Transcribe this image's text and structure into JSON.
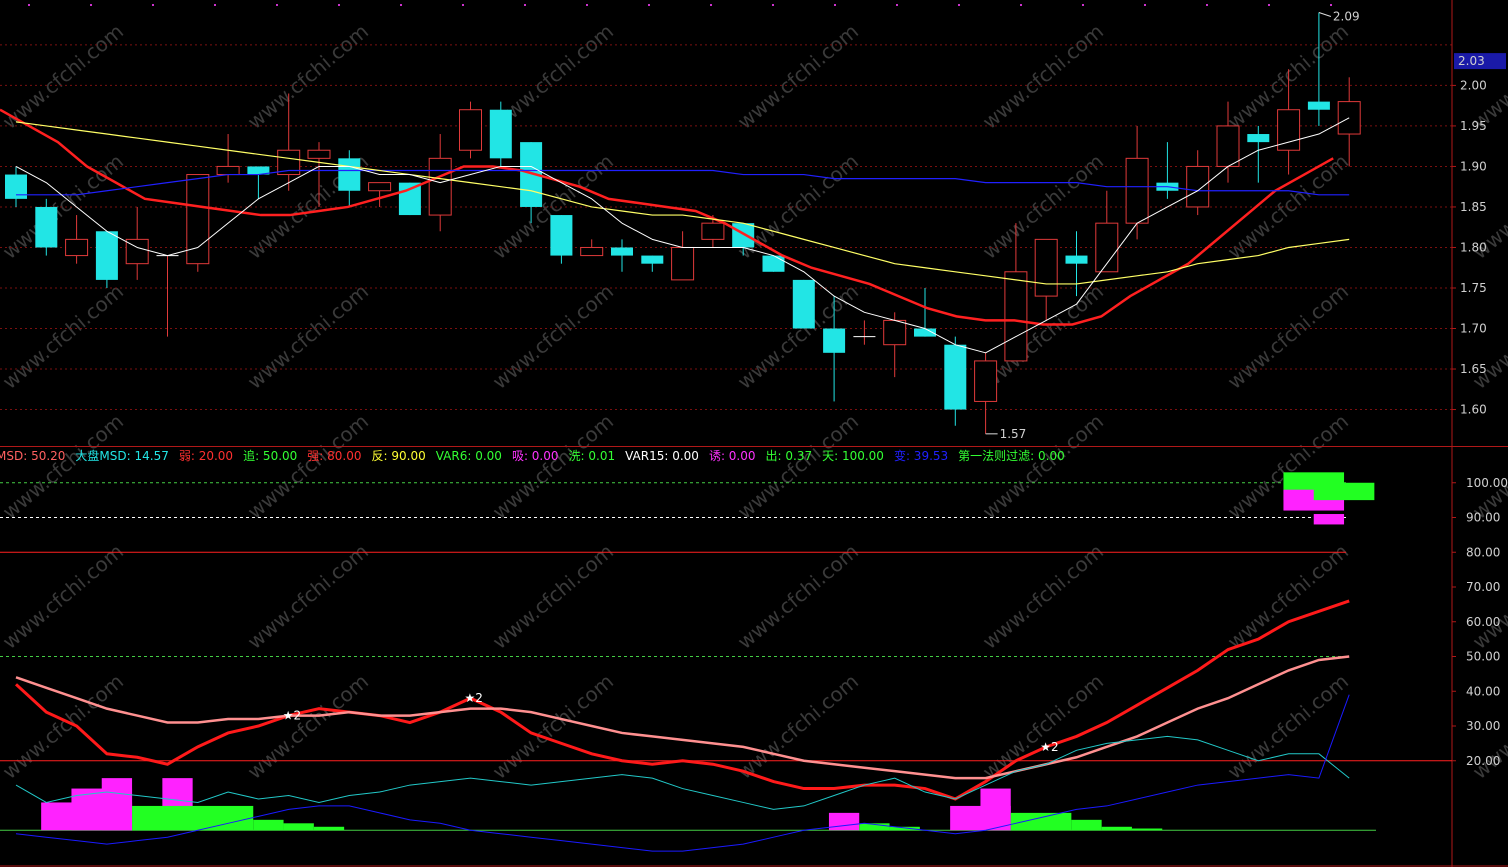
{
  "chart_data": [
    {
      "type": "candlestick",
      "panel": "price",
      "y_ticks": [
        "2.00",
        "1.95",
        "1.90",
        "1.85",
        "1.80",
        "1.75",
        "1.70",
        "1.65",
        "1.60"
      ],
      "ylim": [
        1.555,
        2.098
      ],
      "current_price": "2.03",
      "high_marker": "2.09",
      "low_marker": "1.57",
      "high_index": 43,
      "low_index": 32,
      "colors": {
        "up": "#e03a3a",
        "down": "#22e5e5",
        "ma1": "#ffffff",
        "ma2": "#ff2020",
        "ma3": "#ffff66",
        "ma4": "#2020ff"
      },
      "candles": [
        {
          "o": 1.89,
          "h": 1.9,
          "l": 1.85,
          "c": 1.86
        },
        {
          "o": 1.85,
          "h": 1.86,
          "l": 1.79,
          "c": 1.8
        },
        {
          "o": 1.79,
          "h": 1.84,
          "l": 1.78,
          "c": 1.81
        },
        {
          "o": 1.82,
          "h": 1.82,
          "l": 1.75,
          "c": 1.76
        },
        {
          "o": 1.78,
          "h": 1.85,
          "l": 1.76,
          "c": 1.81
        },
        {
          "o": 1.79,
          "h": 1.79,
          "l": 1.69,
          "c": 1.79
        },
        {
          "o": 1.78,
          "h": 1.89,
          "l": 1.77,
          "c": 1.89
        },
        {
          "o": 1.89,
          "h": 1.94,
          "l": 1.88,
          "c": 1.9
        },
        {
          "o": 1.9,
          "h": 1.9,
          "l": 1.86,
          "c": 1.89
        },
        {
          "o": 1.89,
          "h": 1.99,
          "l": 1.87,
          "c": 1.92
        },
        {
          "o": 1.91,
          "h": 1.93,
          "l": 1.85,
          "c": 1.92
        },
        {
          "o": 1.91,
          "h": 1.92,
          "l": 1.85,
          "c": 1.87
        },
        {
          "o": 1.87,
          "h": 1.88,
          "l": 1.85,
          "c": 1.88
        },
        {
          "o": 1.88,
          "h": 1.88,
          "l": 1.84,
          "c": 1.84
        },
        {
          "o": 1.84,
          "h": 1.94,
          "l": 1.82,
          "c": 1.91
        },
        {
          "o": 1.92,
          "h": 1.98,
          "l": 1.91,
          "c": 1.97
        },
        {
          "o": 1.97,
          "h": 1.98,
          "l": 1.9,
          "c": 1.91
        },
        {
          "o": 1.93,
          "h": 1.93,
          "l": 1.83,
          "c": 1.85
        },
        {
          "o": 1.84,
          "h": 1.84,
          "l": 1.78,
          "c": 1.79
        },
        {
          "o": 1.79,
          "h": 1.81,
          "l": 1.79,
          "c": 1.8
        },
        {
          "o": 1.8,
          "h": 1.81,
          "l": 1.77,
          "c": 1.79
        },
        {
          "o": 1.79,
          "h": 1.79,
          "l": 1.77,
          "c": 1.78
        },
        {
          "o": 1.76,
          "h": 1.82,
          "l": 1.76,
          "c": 1.8
        },
        {
          "o": 1.81,
          "h": 1.84,
          "l": 1.8,
          "c": 1.83
        },
        {
          "o": 1.83,
          "h": 1.83,
          "l": 1.79,
          "c": 1.8
        },
        {
          "o": 1.79,
          "h": 1.79,
          "l": 1.77,
          "c": 1.77
        },
        {
          "o": 1.76,
          "h": 1.76,
          "l": 1.7,
          "c": 1.7
        },
        {
          "o": 1.7,
          "h": 1.74,
          "l": 1.61,
          "c": 1.67
        },
        {
          "o": 1.69,
          "h": 1.71,
          "l": 1.68,
          "c": 1.69
        },
        {
          "o": 1.68,
          "h": 1.72,
          "l": 1.64,
          "c": 1.71
        },
        {
          "o": 1.7,
          "h": 1.75,
          "l": 1.69,
          "c": 1.69
        },
        {
          "o": 1.68,
          "h": 1.69,
          "l": 1.58,
          "c": 1.6
        },
        {
          "o": 1.61,
          "h": 1.67,
          "l": 1.57,
          "c": 1.66
        },
        {
          "o": 1.66,
          "h": 1.83,
          "l": 1.66,
          "c": 1.77
        },
        {
          "o": 1.74,
          "h": 1.81,
          "l": 1.71,
          "c": 1.81
        },
        {
          "o": 1.79,
          "h": 1.82,
          "l": 1.74,
          "c": 1.78
        },
        {
          "o": 1.77,
          "h": 1.87,
          "l": 1.77,
          "c": 1.83
        },
        {
          "o": 1.83,
          "h": 1.95,
          "l": 1.81,
          "c": 1.91
        },
        {
          "o": 1.88,
          "h": 1.93,
          "l": 1.86,
          "c": 1.87
        },
        {
          "o": 1.85,
          "h": 1.92,
          "l": 1.84,
          "c": 1.9
        },
        {
          "o": 1.9,
          "h": 1.98,
          "l": 1.88,
          "c": 1.95
        },
        {
          "o": 1.94,
          "h": 1.95,
          "l": 1.88,
          "c": 1.93
        },
        {
          "o": 1.92,
          "h": 2.02,
          "l": 1.89,
          "c": 1.97
        },
        {
          "o": 1.98,
          "h": 2.09,
          "l": 1.95,
          "c": 1.97
        },
        {
          "o": 1.94,
          "h": 2.01,
          "l": 1.9,
          "c": 1.98
        }
      ],
      "ma_fast": [
        1.9,
        1.88,
        1.85,
        1.82,
        1.8,
        1.79,
        1.8,
        1.83,
        1.86,
        1.88,
        1.9,
        1.9,
        1.89,
        1.89,
        1.88,
        1.89,
        1.9,
        1.9,
        1.88,
        1.86,
        1.83,
        1.81,
        1.8,
        1.8,
        1.8,
        1.79,
        1.77,
        1.74,
        1.72,
        1.71,
        1.7,
        1.68,
        1.67,
        1.69,
        1.71,
        1.73,
        1.78,
        1.83,
        1.85,
        1.87,
        1.9,
        1.92,
        1.93,
        1.94,
        1.96
      ],
      "ma_mid": [
        1.97,
        1.95,
        1.93,
        1.9,
        1.88,
        1.86,
        1.855,
        1.85,
        1.845,
        1.84,
        1.84,
        1.845,
        1.85,
        1.86,
        1.87,
        1.885,
        1.9,
        1.9,
        1.895,
        1.885,
        1.875,
        1.86,
        1.855,
        1.85,
        1.845,
        1.83,
        1.81,
        1.79,
        1.775,
        1.765,
        1.755,
        1.74,
        1.725,
        1.715,
        1.71,
        1.71,
        1.705,
        1.705,
        1.715,
        1.74,
        1.76,
        1.78,
        1.81,
        1.84,
        1.87,
        1.89,
        1.91
      ],
      "ma_slow": [
        1.955,
        1.95,
        1.945,
        1.94,
        1.935,
        1.93,
        1.925,
        1.92,
        1.915,
        1.91,
        1.905,
        1.9,
        1.895,
        1.89,
        1.885,
        1.88,
        1.875,
        1.87,
        1.86,
        1.85,
        1.845,
        1.84,
        1.84,
        1.835,
        1.83,
        1.82,
        1.81,
        1.8,
        1.79,
        1.78,
        1.775,
        1.77,
        1.765,
        1.76,
        1.755,
        1.755,
        1.76,
        1.765,
        1.77,
        1.78,
        1.785,
        1.79,
        1.8,
        1.805,
        1.81
      ],
      "ma_long": [
        1.865,
        1.865,
        1.865,
        1.87,
        1.875,
        1.88,
        1.885,
        1.89,
        1.89,
        1.895,
        1.895,
        1.895,
        1.895,
        1.895,
        1.895,
        1.895,
        1.895,
        1.895,
        1.895,
        1.895,
        1.895,
        1.895,
        1.895,
        1.895,
        1.89,
        1.89,
        1.89,
        1.885,
        1.885,
        1.885,
        1.885,
        1.885,
        1.88,
        1.88,
        1.88,
        1.88,
        1.875,
        1.875,
        1.875,
        1.87,
        1.87,
        1.87,
        1.87,
        1.865,
        1.865
      ]
    },
    {
      "type": "line",
      "panel": "indicator",
      "legend": [
        {
          "label": "MSD: 50.20",
          "color": "#ff6060"
        },
        {
          "label": "大盘MSD: 14.57",
          "color": "#22e5e5"
        },
        {
          "label": "弱: 20.00",
          "color": "#ff3030"
        },
        {
          "label": "追: 50.00",
          "color": "#33ff33"
        },
        {
          "label": "强: 80.00",
          "color": "#ff3030"
        },
        {
          "label": "反: 90.00",
          "color": "#ffff33"
        },
        {
          "label": "VAR6: 0.00",
          "color": "#33ff33"
        },
        {
          "label": "吸: 0.00",
          "color": "#ff33ff"
        },
        {
          "label": "洗: 0.01",
          "color": "#33ff33"
        },
        {
          "label": "VAR15: 0.00",
          "color": "#ffffff"
        },
        {
          "label": "诱: 0.00",
          "color": "#ff33ff"
        },
        {
          "label": "出: 0.37",
          "color": "#33ff33"
        },
        {
          "label": "天: 100.00",
          "color": "#33ff33"
        },
        {
          "label": "变: 39.53",
          "color": "#2020ff"
        },
        {
          "label": "第一法则过滤: 0.00",
          "color": "#33ff33"
        }
      ],
      "y_ticks": [
        "100.00",
        "90.00",
        "80.00",
        "70.00",
        "60.00",
        "50.00",
        "40.00",
        "30.00",
        "20.00"
      ],
      "ylim": [
        -10,
        110
      ],
      "levels": [
        {
          "name": "强",
          "value": 80,
          "color": "#ff2020",
          "style": "solid"
        },
        {
          "name": "追",
          "value": 50,
          "color": "#44cc44",
          "style": "dotted"
        },
        {
          "name": "弱",
          "value": 20,
          "color": "#ff2020",
          "style": "solid"
        },
        {
          "name": "反",
          "value": 90,
          "color": "#ffffff",
          "style": "dotted"
        },
        {
          "name": "天",
          "value": 100,
          "color": "#44cc44",
          "style": "dotted"
        }
      ],
      "stars": [
        {
          "index": 9,
          "label": "★2"
        },
        {
          "index": 15,
          "label": "★2"
        },
        {
          "index": 34,
          "label": "★2"
        }
      ],
      "series": [
        {
          "color": "#ff1a1a",
          "values": [
            42,
            34,
            30,
            22,
            21,
            19,
            24,
            28,
            30,
            33,
            35,
            34,
            33,
            31,
            34,
            38,
            34,
            28,
            25,
            22,
            20,
            19,
            20,
            19,
            17,
            14,
            12,
            12,
            13,
            13,
            12,
            9,
            14,
            20,
            24,
            27,
            31,
            36,
            41,
            46,
            52,
            55,
            60,
            63,
            66
          ]
        },
        {
          "color": "#ff9090",
          "values": [
            44,
            41,
            38,
            35,
            33,
            31,
            31,
            32,
            32,
            33,
            33,
            34,
            33,
            33,
            34,
            35,
            35,
            34,
            32,
            30,
            28,
            27,
            26,
            25,
            24,
            22,
            20,
            19,
            18,
            17,
            16,
            15,
            15,
            17,
            19,
            21,
            24,
            27,
            31,
            35,
            38,
            42,
            46,
            49,
            50
          ]
        },
        {
          "color": "#22c8c8",
          "values": [
            13,
            8,
            10,
            11,
            10,
            9,
            8,
            11,
            9,
            10,
            8,
            10,
            11,
            13,
            14,
            15,
            14,
            13,
            14,
            15,
            16,
            15,
            12,
            10,
            8,
            6,
            7,
            10,
            13,
            15,
            11,
            9,
            13,
            17,
            19,
            23,
            25,
            26,
            27,
            26,
            23,
            20,
            22,
            22,
            15
          ]
        },
        {
          "color": "#1a1aff",
          "values": [
            -1,
            -2,
            -3,
            -4,
            -3,
            -2,
            0,
            2,
            4,
            6,
            7,
            7,
            5,
            3,
            2,
            0,
            -1,
            -2,
            -3,
            -4,
            -5,
            -6,
            -6,
            -5,
            -4,
            -2,
            0,
            1,
            2,
            1,
            0,
            -1,
            0,
            2,
            4,
            6,
            7,
            9,
            11,
            13,
            14,
            15,
            16,
            15,
            39
          ]
        }
      ],
      "bars": [
        {
          "from": 1,
          "to": 4,
          "h": 8,
          "color": "#ff22ff"
        },
        {
          "from": 2,
          "to": 4,
          "h": 12,
          "color": "#ff22ff"
        },
        {
          "from": 3,
          "to": 4,
          "h": 15,
          "color": "#ff22ff"
        },
        {
          "from": 5,
          "to": 6,
          "h": 15,
          "color": "#ff22ff"
        },
        {
          "from": 4,
          "to": 8,
          "h": 7,
          "color": "#22ff22"
        },
        {
          "from": 8,
          "to": 9,
          "h": 3,
          "color": "#22ff22"
        },
        {
          "from": 9,
          "to": 10,
          "h": 2,
          "color": "#22ff22"
        },
        {
          "from": 10,
          "to": 11,
          "h": 1,
          "color": "#22ff22"
        },
        {
          "from": 27,
          "to": 28,
          "h": 5,
          "color": "#ff22ff"
        },
        {
          "from": 28,
          "to": 29,
          "h": 2,
          "color": "#22ff22"
        },
        {
          "from": 29,
          "to": 30,
          "h": 1,
          "color": "#22ff22"
        },
        {
          "from": 31,
          "to": 33,
          "h": 7,
          "color": "#ff22ff"
        },
        {
          "from": 32,
          "to": 33,
          "h": 12,
          "color": "#ff22ff"
        },
        {
          "from": 33,
          "to": 35,
          "h": 5,
          "color": "#22ff22"
        },
        {
          "from": 35,
          "to": 36,
          "h": 3,
          "color": "#22ff22"
        },
        {
          "from": 36,
          "to": 37,
          "h": 1,
          "color": "#22ff22"
        },
        {
          "from": 37,
          "to": 38,
          "h": 0.5,
          "color": "#22ff22"
        },
        {
          "from": 42,
          "to": 44,
          "h": 103,
          "base": 95,
          "color": "#22ff22"
        },
        {
          "from": 42,
          "to": 44,
          "h": 98,
          "base": 92,
          "color": "#ff22ff"
        },
        {
          "from": 43,
          "to": 45,
          "h": 100,
          "base": 95,
          "color": "#22ff22"
        },
        {
          "from": 43,
          "to": 44,
          "h": 91,
          "base": 88,
          "color": "#ff22ff"
        }
      ]
    }
  ],
  "watermark": "www.cfchi.com"
}
